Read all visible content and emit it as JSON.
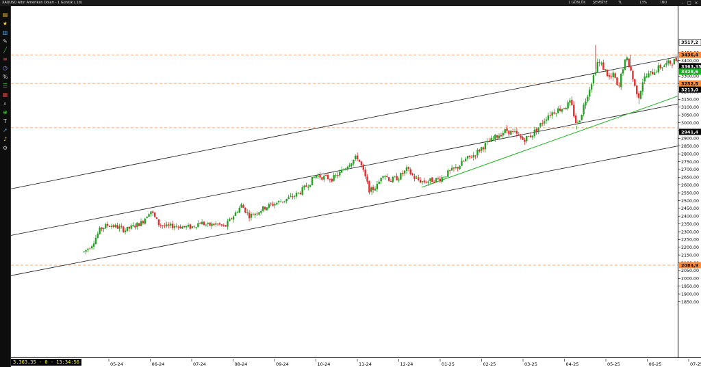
{
  "window": {
    "title": "XAUUSD Altın Amerikan Doları - 1 Günlük (.1d)",
    "controls": [
      "1 GÜNLÜK",
      "ŞEMSİYE",
      "TL",
      "13%",
      "İNO"
    ]
  },
  "toolbar": {
    "icons": [
      "folder-icon",
      "star-icon",
      "chart-icon",
      "pencil-icon",
      "trend-icon",
      "level-icon",
      "clock-icon",
      "percent-icon",
      "list-icon",
      "grid-icon",
      "zoom-icon",
      "magnet-icon",
      "text-icon",
      "arrow-icon",
      "bell-icon",
      "gear-icon"
    ]
  },
  "status": {
    "readout": "3.363,35 - 0 - 13:34:56"
  },
  "colors": {
    "up": "#25a025",
    "down": "#e52c2c",
    "channel": "#2a2a2a",
    "support": "#2eb82e",
    "hline": "#ff8a3a",
    "last_price_bg": "#000000",
    "green_tag_bg": "#16b01c"
  },
  "chart_data": {
    "type": "candlestick",
    "title": "",
    "xlabel": "",
    "ylabel": "",
    "ylim": [
      1800,
      3600
    ],
    "grid": false,
    "x_ticks": [
      "05-24",
      "06-24",
      "07-24",
      "08-24",
      "09-24",
      "10-24",
      "11-24",
      "12-24",
      "01-25",
      "02-25",
      "03-25",
      "04-25",
      "05-25",
      "06-25",
      "07-25"
    ],
    "y_ticks": [
      "3450,00",
      "3400,00",
      "3350,00",
      "3300,00",
      "3250,00",
      "3200,00",
      "3150,00",
      "3100,00",
      "3050,00",
      "3000,00",
      "2950,00",
      "2900,00",
      "2850,00",
      "2800,00",
      "2750,00",
      "2700,00",
      "2650,00",
      "2600,00",
      "2550,00",
      "2500,00",
      "2450,00",
      "2400,00",
      "2350,00",
      "2300,00",
      "2250,00",
      "2200,00",
      "2150,00",
      "2100,00",
      "2050,00",
      "2000,00",
      "1950,00",
      "1900,00",
      "1850,00"
    ],
    "price_tags": [
      {
        "label": "3517,2",
        "value": 3517.2,
        "style": "white"
      },
      {
        "label": "3436,4",
        "value": 3436.4,
        "style": "orange"
      },
      {
        "label": "3363,35",
        "value": 3363.35,
        "style": "black"
      },
      {
        "label": "3328,6",
        "value": 3328.6,
        "style": "green"
      },
      {
        "label": "3252,5",
        "value": 3252.5,
        "style": "orange"
      },
      {
        "label": "3213,0",
        "value": 3213.0,
        "style": "black"
      },
      {
        "label": "2941,4",
        "value": 2941.4,
        "style": "black"
      },
      {
        "label": "2084,9",
        "value": 2084.9,
        "style": "orange"
      }
    ],
    "horizontal_levels": [
      3436.4,
      3252.5,
      2968,
      2084.9
    ],
    "trendlines": [
      {
        "name": "upper-channel",
        "color": "channel",
        "from": {
          "month": 0,
          "price": 2700
        },
        "to": {
          "month": 15.5,
          "price": 3517.2
        }
      },
      {
        "name": "middle-channel",
        "color": "channel",
        "from": {
          "month": 0,
          "price": 2400
        },
        "to": {
          "month": 15.5,
          "price": 3213
        }
      },
      {
        "name": "lower-channel",
        "color": "channel",
        "from": {
          "month": 0,
          "price": 2140
        },
        "to": {
          "month": 15.5,
          "price": 2941.4
        }
      },
      {
        "name": "support-trend",
        "color": "support",
        "from": {
          "month": 7.55,
          "price": 2585
        },
        "to": {
          "month": 15.4,
          "price": 3328.6
        }
      }
    ],
    "close_path": [
      [
        -0.6,
        2170
      ],
      [
        -0.4,
        2220
      ],
      [
        -0.2,
        2320
      ],
      [
        0.0,
        2345
      ],
      [
        0.2,
        2330
      ],
      [
        0.4,
        2310
      ],
      [
        0.6,
        2335
      ],
      [
        0.8,
        2360
      ],
      [
        1.0,
        2440
      ],
      [
        1.2,
        2350
      ],
      [
        1.4,
        2330
      ],
      [
        1.6,
        2340
      ],
      [
        1.8,
        2330
      ],
      [
        2.0,
        2330
      ],
      [
        2.2,
        2360
      ],
      [
        2.4,
        2340
      ],
      [
        2.6,
        2350
      ],
      [
        2.8,
        2330
      ],
      [
        3.0,
        2400
      ],
      [
        3.2,
        2470
      ],
      [
        3.4,
        2400
      ],
      [
        3.6,
        2430
      ],
      [
        3.8,
        2460
      ],
      [
        4.0,
        2480
      ],
      [
        4.2,
        2500
      ],
      [
        4.4,
        2520
      ],
      [
        4.6,
        2550
      ],
      [
        4.8,
        2600
      ],
      [
        5.0,
        2660
      ],
      [
        5.2,
        2650
      ],
      [
        5.4,
        2640
      ],
      [
        5.6,
        2680
      ],
      [
        5.8,
        2740
      ],
      [
        6.0,
        2780
      ],
      [
        6.1,
        2720
      ],
      [
        6.2,
        2640
      ],
      [
        6.3,
        2560
      ],
      [
        6.5,
        2600
      ],
      [
        6.6,
        2680
      ],
      [
        6.8,
        2630
      ],
      [
        7.0,
        2650
      ],
      [
        7.2,
        2700
      ],
      [
        7.4,
        2640
      ],
      [
        7.6,
        2620
      ],
      [
        7.8,
        2630
      ],
      [
        8.0,
        2640
      ],
      [
        8.2,
        2680
      ],
      [
        8.4,
        2710
      ],
      [
        8.6,
        2760
      ],
      [
        8.8,
        2790
      ],
      [
        9.0,
        2840
      ],
      [
        9.2,
        2880
      ],
      [
        9.4,
        2920
      ],
      [
        9.6,
        2950
      ],
      [
        9.8,
        2930
      ],
      [
        10.0,
        2890
      ],
      [
        10.2,
        2920
      ],
      [
        10.4,
        2980
      ],
      [
        10.6,
        3050
      ],
      [
        10.8,
        3080
      ],
      [
        11.0,
        3100
      ],
      [
        11.15,
        3130
      ],
      [
        11.3,
        2980
      ],
      [
        11.4,
        3050
      ],
      [
        11.5,
        3140
      ],
      [
        11.6,
        3220
      ],
      [
        11.7,
        3300
      ],
      [
        11.8,
        3390
      ],
      [
        11.9,
        3370
      ],
      [
        12.0,
        3330
      ],
      [
        12.1,
        3280
      ],
      [
        12.2,
        3310
      ],
      [
        12.3,
        3200
      ],
      [
        12.4,
        3350
      ],
      [
        12.5,
        3410
      ],
      [
        12.6,
        3340
      ],
      [
        12.7,
        3230
      ],
      [
        12.8,
        3170
      ],
      [
        12.9,
        3280
      ],
      [
        13.0,
        3300
      ],
      [
        13.2,
        3340
      ],
      [
        13.4,
        3370
      ],
      [
        13.6,
        3390
      ],
      [
        13.8,
        3420
      ],
      [
        14.0,
        3390
      ],
      [
        14.2,
        3350
      ],
      [
        14.4,
        3320
      ],
      [
        14.6,
        3300
      ],
      [
        14.8,
        3330
      ],
      [
        15.0,
        3320
      ],
      [
        15.2,
        3350
      ],
      [
        15.4,
        3363.35
      ]
    ],
    "spikes": [
      [
        11.75,
        3500
      ],
      [
        12.6,
        3437
      ],
      [
        12.8,
        3120
      ],
      [
        13.9,
        3450
      ],
      [
        11.3,
        2957
      ],
      [
        6.35,
        2537
      ]
    ]
  }
}
